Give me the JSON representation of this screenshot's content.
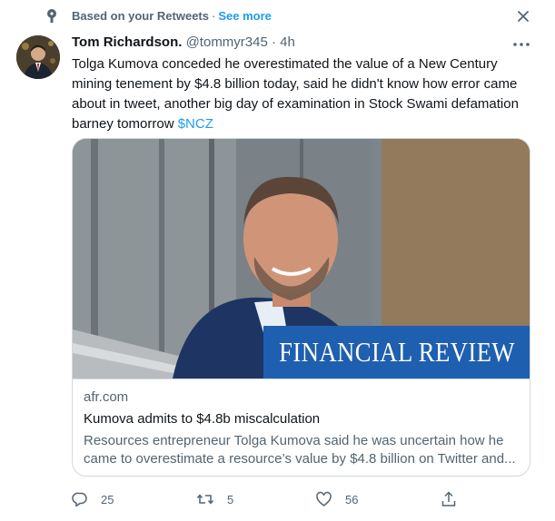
{
  "context": {
    "label": "Based on your Retweets",
    "separator": "·",
    "see_more": "See more",
    "icon": "sparkle-icon"
  },
  "tweet": {
    "name": "Tom Richardson.",
    "handle": "@tommyr345",
    "dot": "·",
    "time": "4h",
    "text": "Tolga Kumova conceded he overestimated the value of a New Century mining tenement by $4.8 billion today, said he didn't know how error came about in tweet, another big day of examination in Stock Swami defamation barney tomorrow",
    "cashtag": "$NCZ"
  },
  "card": {
    "brand_banner": "FINANCIAL REVIEW",
    "domain": "afr.com",
    "title": "Kumova admits to $4.8b miscalculation",
    "description": "Resources entrepreneur Tolga Kumova said he was uncertain how he came to overestimate a resource’s value by $4.8 billion on Twitter and..."
  },
  "actions": {
    "replies": "25",
    "retweets": "5",
    "likes": "56"
  },
  "colors": {
    "accent": "#1d9bf0",
    "banner_blue": "#1f5fb0",
    "muted_text": "#536471"
  }
}
